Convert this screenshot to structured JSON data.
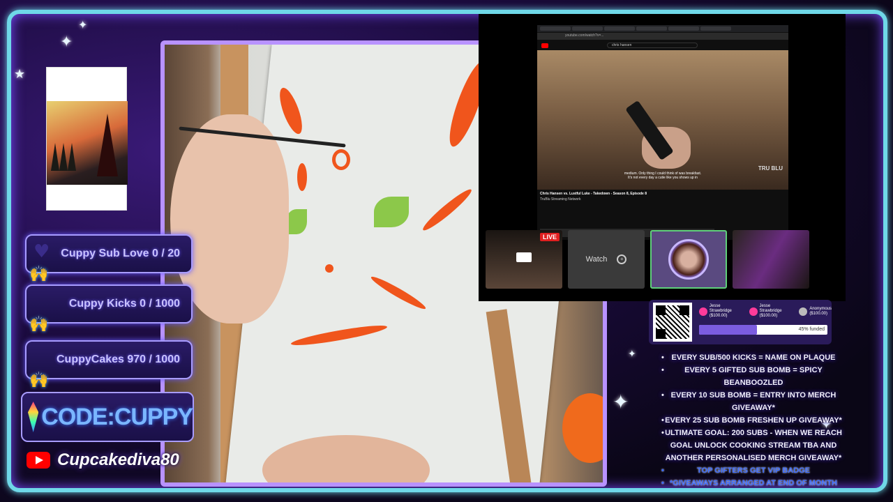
{
  "goals": [
    {
      "label": "Cuppy Sub Love 0 / 20"
    },
    {
      "label": "Cuppy Kicks 0 / 1000"
    },
    {
      "label": "CuppyCakes 970 / 1000"
    }
  ],
  "code": {
    "label": "CODE:CUPPY"
  },
  "social": {
    "icon": "youtube-icon",
    "handle": "Cupcakediva80"
  },
  "screen_share": {
    "browser": {
      "address": "youtube.com/watch?v=...",
      "search_query": "chris hansen",
      "video_subtitle": "medium. Only thing I could think of was breakfast.",
      "video_subtitle_2": "It's not every day a cutie like you shows up in",
      "watermark": "TRU BLU",
      "video_title": "Chris Hansen vs. Lustful Luke - Takedown - Season 8, Episode 8",
      "channel": "TruBlu Streaming Network"
    },
    "tiles": [
      {
        "name": "live-camera",
        "badge": "LIVE"
      },
      {
        "name": "watch",
        "label": "Watch"
      },
      {
        "name": "avatar"
      },
      {
        "name": "second-camera"
      }
    ]
  },
  "donation": {
    "donors": [
      {
        "name": "Jesse Strawbridge",
        "amount": "($100.00)"
      },
      {
        "name": "Jesse Strawbridge",
        "amount": "($100.00)"
      },
      {
        "name": "Anonymous",
        "amount": "($100.00)"
      }
    ],
    "progress_label": "45% funded",
    "progress": 0.45
  },
  "rules": [
    {
      "text": "EVERY SUB/500 KICKS = NAME ON PLAQUE"
    },
    {
      "text": "EVERY 5 GIFTED SUB BOMB = SPICY BEANBOOZLED"
    },
    {
      "text": "EVERY 10 SUB BOMB = ENTRY INTO MERCH GIVEAWAY*"
    },
    {
      "text": "EVERY 25 SUB BOMB FRESHEN UP GIVEAWAY*"
    },
    {
      "text": "ULTIMATE GOAL: 200 SUBS - WHEN WE REACH GOAL UNLOCK COOKING STREAM TBA AND ANOTHER PERSONALISED MERCH GIVEAWAY*"
    },
    {
      "text": "TOP GIFTERS GET VIP BADGE"
    },
    {
      "text": "*GIVEAWAYS ARRANGED AT END OF MONTH"
    }
  ],
  "colors": {
    "frame": "#6fd8e8",
    "accent": "#b892ff",
    "paint": "#f0551c",
    "eyes": "#8cc84a"
  }
}
